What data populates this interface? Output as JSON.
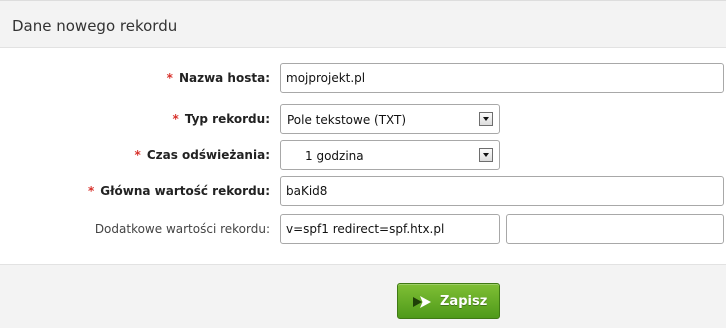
{
  "header": {
    "title": "Dane nowego rekordu"
  },
  "form": {
    "required_marker": "*",
    "host": {
      "label": "Nazwa hosta:",
      "value": "mojprojekt.pl"
    },
    "record_type": {
      "label": "Typ rekordu:",
      "selected": "Pole tekstowe (TXT)"
    },
    "refresh_time": {
      "label": "Czas odświeżania:",
      "selected": "1 godzina"
    },
    "main_value": {
      "label": "Główna wartość rekordu:",
      "value": "baKid8"
    },
    "additional_values": {
      "label": "Dodatkowe wartości rekordu:",
      "value_1": "v=spf1 redirect=spf.htx.pl",
      "value_2": ""
    }
  },
  "footer": {
    "save_label": "Zapisz"
  },
  "colors": {
    "required": "#d8322c",
    "button": "#5ea421",
    "header_bg": "#f3f3f3"
  },
  "icons": {
    "save": "save-arrow-icon",
    "dropdown": "chevron-down-icon"
  }
}
